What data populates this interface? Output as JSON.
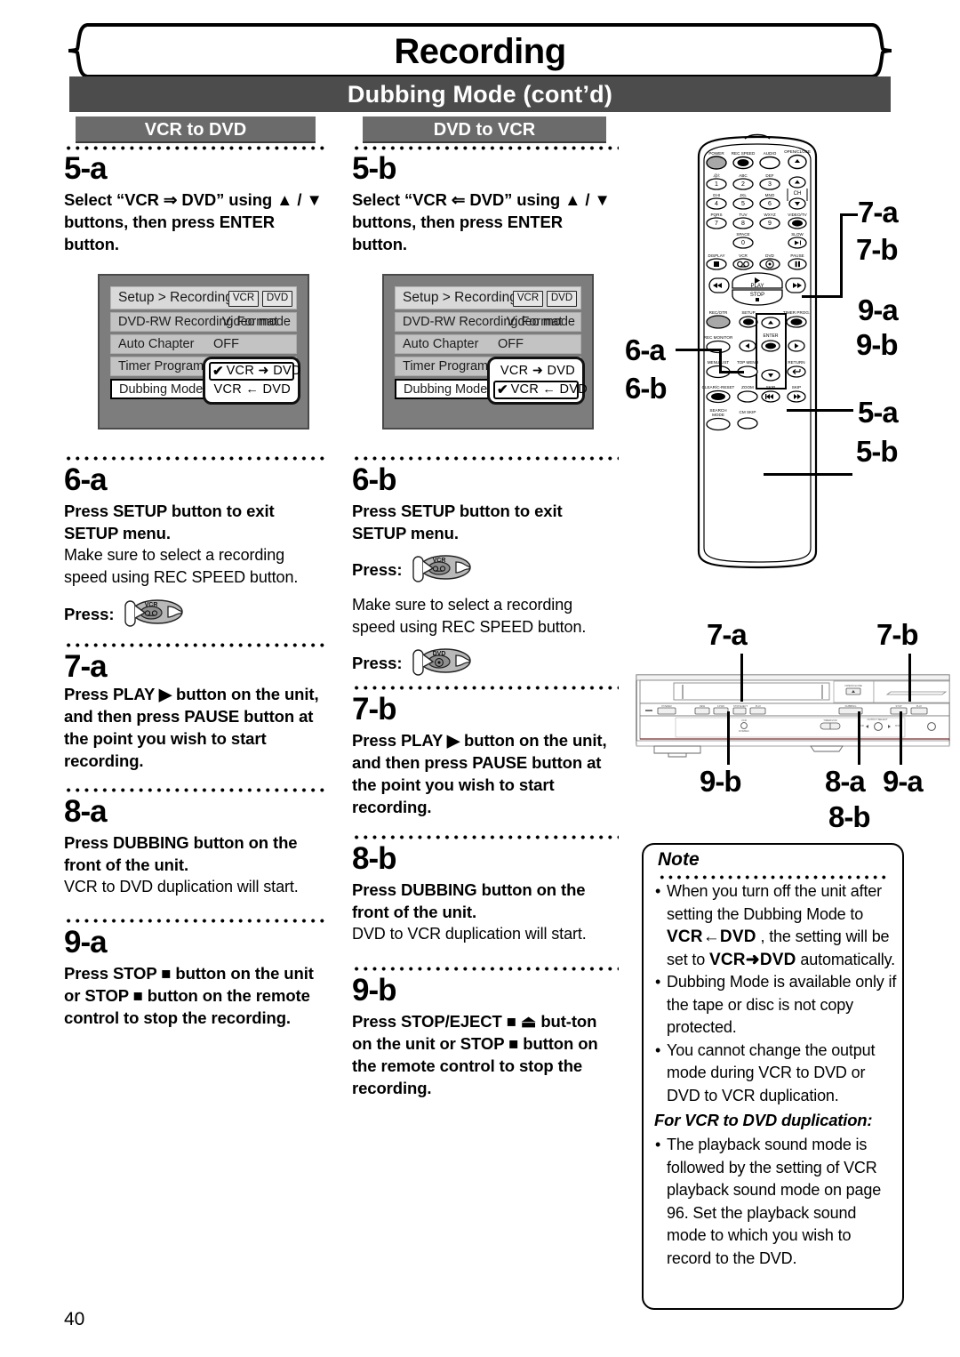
{
  "header": {
    "chapter_title": "Recording",
    "section_title": "Dubbing Mode (cont’d)"
  },
  "tabs": [
    {
      "label": "VCR to DVD"
    },
    {
      "label": "DVD to VCR"
    }
  ],
  "column_a": {
    "steps": [
      {
        "num": "5-a",
        "bold": "Select “VCR ⇒ DVD” using ▲ / ▼ buttons, then press ENTER button.",
        "regular": ""
      },
      {
        "num": "6-a",
        "bold": "Press SETUP button to exit SETUP menu.",
        "regular": "Make sure to select a recording speed using REC SPEED button.",
        "press_label": "Press:",
        "press_icon": "vcr-button-press-icon"
      },
      {
        "num": "7-a",
        "bold": "Press PLAY ▶ button on the unit, and then press PAUSE button at the point you wish to start recording.",
        "regular": ""
      },
      {
        "num": "8-a",
        "bold": "Press DUBBING button on the front of the unit.",
        "regular": "VCR to DVD duplication will start."
      },
      {
        "num": "9-a",
        "bold": "Press STOP ■ button on the unit or STOP ■ button on the remote control to stop the recording.",
        "regular": ""
      }
    ]
  },
  "column_b": {
    "steps": [
      {
        "num": "5-b",
        "bold": "Select “VCR ⇐ DVD” using ▲ / ▼ buttons, then press ENTER button.",
        "regular": ""
      },
      {
        "num": "6-b",
        "bold": "Press SETUP button to exit SETUP menu.",
        "press_label_1": "Press:",
        "press_icon_1": "vcr-button-press-icon",
        "regular": "Make sure to select a recording speed using REC SPEED button.",
        "press_label_2": "Press:",
        "press_icon_2": "dvd-button-press-icon"
      },
      {
        "num": "7-b",
        "bold": "Press PLAY ▶ button on the unit, and then press PAUSE button at the point you wish to start recording.",
        "regular": ""
      },
      {
        "num": "8-b",
        "bold": "Press DUBBING button on the front of the unit.",
        "regular": "DVD to VCR duplication will start."
      },
      {
        "num": "9-b",
        "bold": "Press STOP/EJECT ■ ⏏ but-ton on the unit or STOP ■ button on the remote control to stop the recording.",
        "regular": ""
      }
    ]
  },
  "tv_menu_a": {
    "title": "Setup > Recording",
    "badges": [
      "VCR",
      "DVD"
    ],
    "rows": [
      {
        "label": "DVD-RW Recording Format",
        "value": "Video mode"
      },
      {
        "label": "Auto Chapter",
        "value": "OFF"
      },
      {
        "label": "Timer Programming",
        "value": ""
      },
      {
        "label": "Dubbing Mode",
        "value": ""
      }
    ],
    "popup": [
      {
        "check": "✔",
        "text": "VCR ➜ DVD",
        "selected": true
      },
      {
        "check": "",
        "text": "VCR ← DVD",
        "selected": false
      }
    ]
  },
  "tv_menu_b": {
    "title": "Setup > Recording",
    "badges": [
      "VCR",
      "DVD"
    ],
    "rows": [
      {
        "label": "DVD-RW Recording Format",
        "value": "Video mode"
      },
      {
        "label": "Auto Chapter",
        "value": "OFF"
      },
      {
        "label": "Timer Programming",
        "value": ""
      },
      {
        "label": "Dubbing Mode",
        "value": ""
      }
    ],
    "popup": [
      {
        "check": "",
        "text": "VCR ➜ DVD",
        "selected": false
      },
      {
        "check": "✔",
        "text": "VCR ← DVD",
        "selected": true
      }
    ]
  },
  "remote": {
    "keys": {
      "power": "POWER",
      "rec_speed": "REC SPEED",
      "audio": "AUDIO",
      "open_close": "OPEN/CLOSE",
      "k1_sub": ".@/:",
      "k1": "1",
      "k2_sub": "ABC",
      "k2": "2",
      "k3_sub": "DEF",
      "k3": "3",
      "ch": "CH",
      "k4_sub": "GHI",
      "k4": "4",
      "k5_sub": "JKL",
      "k5": "5",
      "k6_sub": "MNO",
      "k6": "6",
      "k7_sub": "PQRS",
      "k7": "7",
      "k8_sub": "TUV",
      "k8": "8",
      "k9_sub": "WXYZ",
      "k9": "9",
      "video_tv": "VIDEO/TV",
      "space": "SPACE",
      "k0": "0",
      "slow": "SLOW",
      "display": "DISPLAY",
      "vcr": "VCR",
      "dvd": "DVD",
      "pause": "PAUSE",
      "play": "PLAY",
      "stop": "STOP",
      "rec_otr": "REC/OTR",
      "setup": "SETUP",
      "timer_prog": "TIMER PROG.",
      "rec_monitor": "REC MONITOR",
      "enter": "ENTER",
      "menu_list": "MENU/LIST",
      "top_menu": "TOP MENU",
      "return": "RETURN",
      "clear_reset": "CLEAR/C-RESET",
      "zoom": "ZOOM",
      "skip_prev": "SKIP",
      "skip_next": "SKIP",
      "search_mode": "SEARCH MODE",
      "cm_skip": "CM SKIP"
    },
    "callouts": [
      "7-a",
      "7-b",
      "9-a",
      "9-b",
      "6-a",
      "6-b",
      "5-a",
      "5-b"
    ]
  },
  "front_panel": {
    "callouts_top": [
      "7-a",
      "7-b"
    ],
    "callouts_bottom": [
      "9-b",
      "8-a",
      "9-a",
      "8-b"
    ],
    "labels": {
      "power": "POWER",
      "rew": "REW",
      "f_fwd": "F.FWD",
      "stop_eject": "STOP/EJECT",
      "play": "PLAY",
      "open_close": "OPEN/CLOSE",
      "dubbing": "DUBBING",
      "stop": "STOP",
      "play_dvd": "PLAY",
      "vcr_dvd_rec": "VCR DVD/REC",
      "timer_vcr": "TIMER/VCR",
      "output_select": "OUTPUT SELECT",
      "out_vcr": "VCR",
      "out_dvd": "DVD"
    }
  },
  "note": {
    "title": "Note",
    "items": [
      {
        "segments": [
          {
            "t": "When you turn off the unit after setting the Dubbing Mode to ",
            "b": false
          },
          {
            "t": "VCR←DVD",
            "b": true
          },
          {
            "t": " , the setting will be set to ",
            "b": false
          },
          {
            "t": "VCR➜DVD",
            "b": true
          },
          {
            "t": " automatically.",
            "b": false
          }
        ]
      },
      {
        "segments": [
          {
            "t": "Dubbing Mode is available only if the tape or disc is not copy protected.",
            "b": false
          }
        ]
      },
      {
        "segments": [
          {
            "t": "You cannot change the output mode during VCR to DVD or DVD to VCR duplication.",
            "b": false
          }
        ]
      }
    ],
    "subheading": "For VCR to DVD duplication:",
    "items2": [
      {
        "segments": [
          {
            "t": "The playback sound mode is followed by the setting of VCR playback sound mode on page 96. Set the playback sound mode to which you wish to record to the DVD.",
            "b": false
          }
        ]
      }
    ]
  },
  "page_number": "40",
  "colors": {
    "band_dark": "#4c4c4c",
    "tab_gray": "#6b6b6b",
    "tv_bg": "#7d7d7d",
    "tv_row": "#c3c3c3",
    "tv_head": "#d9d9d9"
  }
}
